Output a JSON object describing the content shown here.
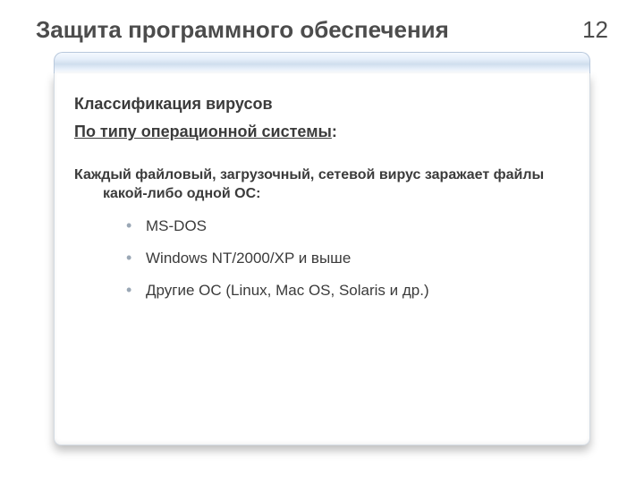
{
  "header": {
    "title": "Защита программного обеспечения",
    "page": "12"
  },
  "content": {
    "subtitle": "Классификация вирусов",
    "classifier_underlined": "По типу операционной системы",
    "classifier_tail": ":",
    "lead_line1": "Каждый файловый, загрузочный, сетевой вирус заражает файлы",
    "lead_line2": "какой-либо одной ОС:",
    "items": [
      "MS-DOS",
      "Windows NT/2000/XP и выше",
      "Другие ОС (Linux, Mac OS, Solaris и др.)"
    ]
  }
}
